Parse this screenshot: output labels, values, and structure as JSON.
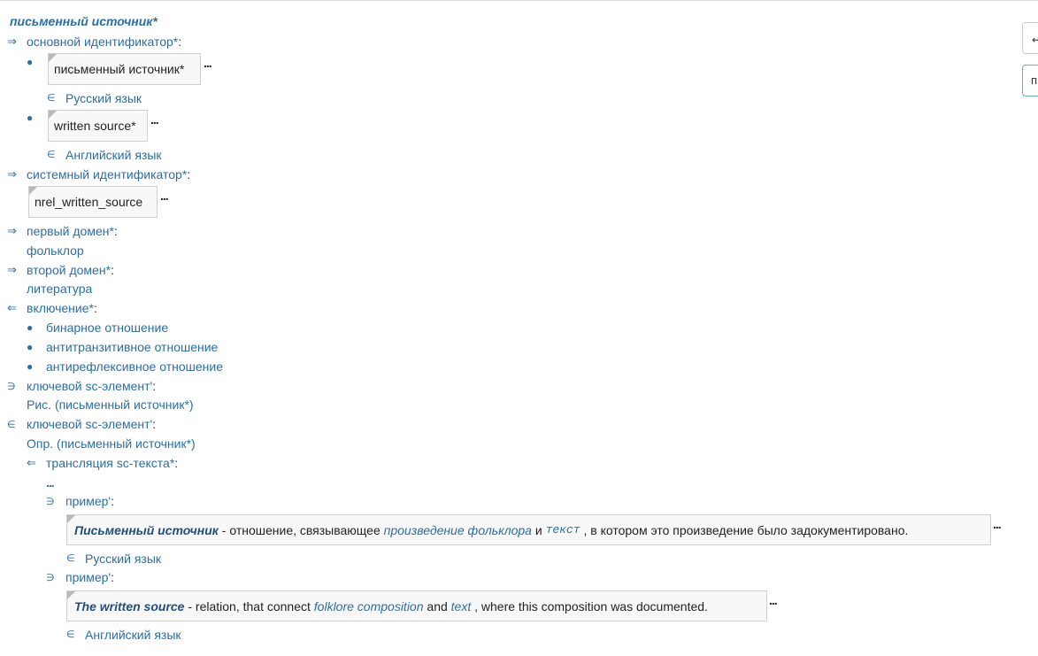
{
  "title": "письменный источник*",
  "ellipsis": "...",
  "sections": {
    "main_id": {
      "arrow": "⇒",
      "label": "основной идентификатор",
      "mark": "*",
      "colon": ":"
    },
    "main_id_items": [
      {
        "bullet": "●",
        "value": "письменный источник*",
        "member": "∈",
        "lang": "Русский язык"
      },
      {
        "bullet": "●",
        "value": "written source*",
        "member": "∈",
        "lang": "Английский язык"
      }
    ],
    "sys_id": {
      "arrow": "⇒",
      "label": "системный идентификатор",
      "mark": "*",
      "colon": ":",
      "value": "nrel_written_source"
    },
    "first_domain": {
      "arrow": "⇒",
      "label": "первый домен",
      "mark": "*",
      "colon": ":",
      "value": "фольклор"
    },
    "second_domain": {
      "arrow": "⇒",
      "label": "второй домен",
      "mark": "*",
      "colon": ":",
      "value": "литература"
    },
    "inclusion": {
      "arrow": "⇐",
      "label": "включение",
      "mark": "*",
      "colon": ":",
      "items": [
        {
          "bullet": "●",
          "label": "бинарное отношение"
        },
        {
          "bullet": "●",
          "label": "антитранзитивное отношение"
        },
        {
          "bullet": "●",
          "label": "антирефлексивное отношение"
        }
      ]
    },
    "key1": {
      "arrow": "∋",
      "label": "ключевой sc-элемент",
      "mark": "'",
      "colon": ":",
      "value": "Рис. (письменный источник*)"
    },
    "key2": {
      "arrow": "∈",
      "label": "ключевой sc-элемент",
      "mark": "'",
      "colon": ":",
      "value": "Опр. (письменный источник*)"
    },
    "translation": {
      "arrow": "⇐",
      "label": "трансляция sc-текста",
      "mark": "*",
      "colon": ":",
      "dots": "..."
    },
    "examples": [
      {
        "arrow": "∋",
        "label": "пример",
        "mark": "'",
        "colon": ":",
        "term": "Письменный источник",
        "part1": " - отношение, связывающее ",
        "link1": "произведение фольклора",
        "part2": " и ",
        "link2": "текст",
        "part3": " , в котором это произведение было задокументировано.",
        "member": "∈",
        "lang": "Русский язык"
      },
      {
        "arrow": "∋",
        "label": "пример",
        "mark": "'",
        "colon": ":",
        "term": "The written source",
        "part1": " - relation, that connect ",
        "link1": "folklore composition",
        "part2": " and ",
        "link2": "text",
        "part3": " , where this composition was documented.",
        "member": "∈",
        "lang": "Английский язык"
      }
    ]
  },
  "right_panel": {
    "btn1_glyph": "↵",
    "btn2_text": "п"
  }
}
